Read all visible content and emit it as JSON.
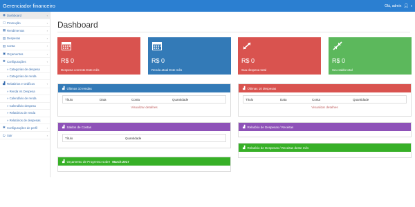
{
  "app": {
    "title": "Gerenciador financeiro",
    "user": "Olá, admin"
  },
  "colors": {
    "red": "#d9534f",
    "blue": "#337ab7",
    "green": "#5cb85c",
    "purple": "#8e52b8",
    "lime": "#37b027",
    "navbar": "#2b7fd1"
  },
  "sidebar": {
    "items": [
      {
        "label": "Dashboard",
        "icon": "dashboard-icon",
        "glyph": "◉",
        "chev": "‹"
      },
      {
        "label": "Promoção",
        "icon": "tag-icon",
        "glyph": "▢",
        "chev": "›"
      },
      {
        "label": "Rendimentos",
        "icon": "money-icon",
        "glyph": "▦",
        "chev": "›"
      },
      {
        "label": "Despesas",
        "icon": "receipt-icon",
        "glyph": "▤",
        "chev": "›"
      },
      {
        "label": "Conta",
        "icon": "bank-icon",
        "glyph": "▥",
        "chev": "›"
      },
      {
        "label": "Orçamentos",
        "icon": "calculator-icon",
        "glyph": "▣",
        "chev": "›"
      },
      {
        "label": "Configurações",
        "icon": "gears-icon",
        "glyph": "✱",
        "chev": "‹"
      },
      {
        "label": "» Categorias de despesa",
        "icon": "",
        "glyph": "",
        "chev": "",
        "sub": true
      },
      {
        "label": "» Categorias de renda",
        "icon": "",
        "glyph": "",
        "chev": "",
        "sub": true
      },
      {
        "label": "Relatórios e Gráficos",
        "icon": "chart-icon",
        "glyph": "▟",
        "chev": "‹"
      },
      {
        "label": "» Renda Vs Despesa",
        "icon": "",
        "glyph": "",
        "chev": "",
        "sub": true
      },
      {
        "label": "» Calendário de renda",
        "icon": "",
        "glyph": "",
        "chev": "",
        "sub": true
      },
      {
        "label": "» Calendário despesa",
        "icon": "",
        "glyph": "",
        "chev": "",
        "sub": true
      },
      {
        "label": "» Relatórios de renda",
        "icon": "",
        "glyph": "",
        "chev": "",
        "sub": true
      },
      {
        "label": "» Relatórios de despesas",
        "icon": "",
        "glyph": "",
        "chev": "",
        "sub": true
      },
      {
        "label": "Configurações de perfil",
        "icon": "user-gear-icon",
        "glyph": "✱",
        "chev": "›"
      },
      {
        "label": "Sair",
        "icon": "logout-icon",
        "glyph": "⏻",
        "chev": "›"
      }
    ]
  },
  "page": {
    "title": "Dashboard"
  },
  "cards": [
    {
      "amount": "R$ 0",
      "label": "Despesa corrente Este mês",
      "icon": "calendar-icon"
    },
    {
      "amount": "R$ 0",
      "label": "Renda atual Este mês",
      "icon": "calendar-icon"
    },
    {
      "amount": "R$ 0",
      "label": "Sua despesa total",
      "icon": "expand-arrows-icon"
    },
    {
      "amount": "R$ 0",
      "label": "Seu saldo total",
      "icon": "compress-arrows-icon"
    }
  ],
  "panels": {
    "last_income": {
      "title": "Últimas 10 rendas",
      "cols": [
        "Título",
        "Data",
        "Conta",
        "Quantidade"
      ],
      "link": "Visualizar detalhes"
    },
    "last_expenses": {
      "title": "Últimas 10 despesas",
      "cols": [
        "Título",
        "Data",
        "Conta",
        "Quantidade"
      ],
      "link": "Visualizar detalhes"
    },
    "account_balance": {
      "title": "Saldos de Contas",
      "cols": [
        "Título",
        "Quantidade"
      ]
    },
    "expense_income_report": {
      "title": "Relatório de Despesas / Receitas"
    },
    "monthly_report": {
      "title": "Relatório de Despesas / Receitas deste mês"
    },
    "budget": {
      "title": "Orçamento de Progresso sobre ",
      "month": "March 2017"
    }
  }
}
